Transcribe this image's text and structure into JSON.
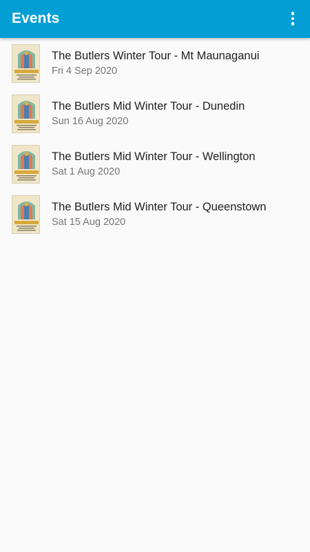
{
  "appbar": {
    "title": "Events",
    "menu_icon": "more-vert-icon",
    "color": "#039fd4"
  },
  "events": [
    {
      "title": "The Butlers Winter Tour - Mt Maunaganui",
      "date": "Fri 4 Sep 2020",
      "poster_text": "THE BUTLERS"
    },
    {
      "title": "The Butlers Mid Winter Tour - Dunedin",
      "date": "Sun 16 Aug 2020",
      "poster_text": "THE BUTLERS"
    },
    {
      "title": "The Butlers Mid Winter Tour - Wellington",
      "date": "Sat 1 Aug 2020",
      "poster_text": "THE BUTLERS"
    },
    {
      "title": "The Butlers Mid Winter Tour - Queenstown",
      "date": "Sat 15 Aug 2020",
      "poster_text": "THE BUTLERS"
    }
  ]
}
